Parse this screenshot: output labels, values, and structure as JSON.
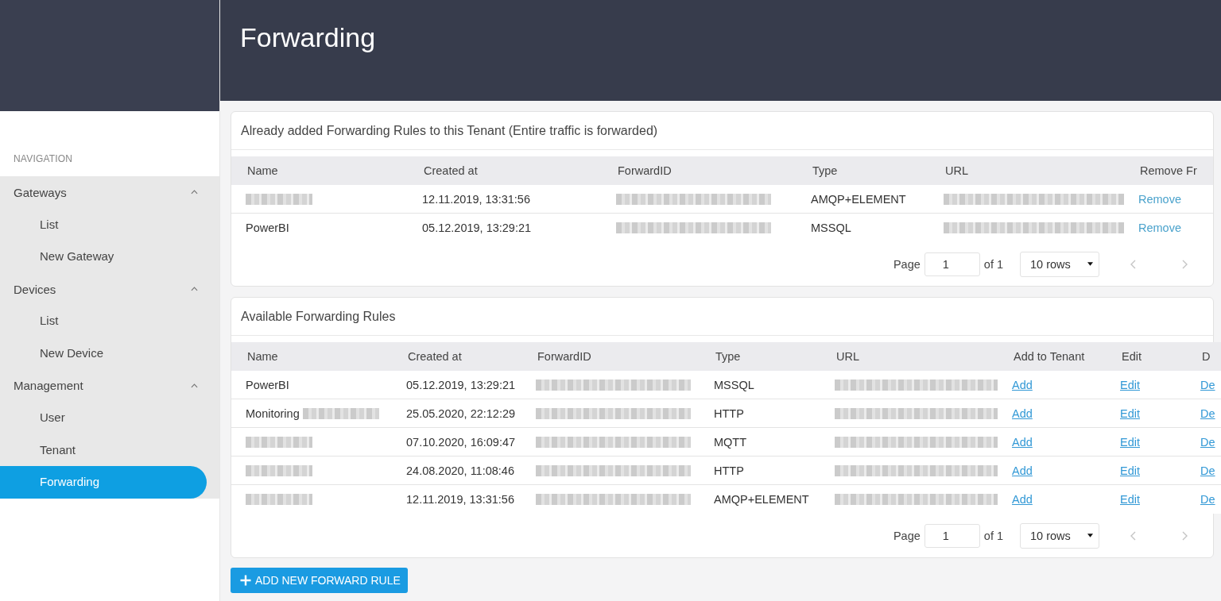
{
  "sidebar": {
    "heading": "NAVIGATION",
    "groups": [
      {
        "label": "Gateways",
        "expanded": true,
        "children": [
          {
            "label": "List",
            "selected": false
          },
          {
            "label": "New Gateway",
            "selected": false
          }
        ]
      },
      {
        "label": "Devices",
        "expanded": true,
        "children": [
          {
            "label": "List",
            "selected": false
          },
          {
            "label": "New Device",
            "selected": false
          }
        ]
      },
      {
        "label": "Management",
        "expanded": true,
        "children": [
          {
            "label": "User",
            "selected": false
          },
          {
            "label": "Tenant",
            "selected": false
          },
          {
            "label": "Forwarding",
            "selected": true
          }
        ]
      }
    ]
  },
  "header": {
    "title": "Forwarding"
  },
  "assigned_rules": {
    "title": "Already added Forwarding Rules to this Tenant (Entire traffic is forwarded)",
    "columns": [
      "Name",
      "Created at",
      "ForwardID",
      "Type",
      "URL",
      "Remove Fr"
    ],
    "rows": [
      {
        "name_redacted": true,
        "created_at": "12.11.2019, 13:31:56",
        "forward_id_redacted": true,
        "type": "AMQP+ELEMENT",
        "url_redacted": true,
        "remove": "Remove"
      },
      {
        "name": "PowerBI",
        "name_redacted": false,
        "created_at": "05.12.2019, 13:29:21",
        "forward_id_redacted": true,
        "type": "MSSQL",
        "url_redacted": true,
        "remove": "Remove"
      }
    ],
    "pagination": {
      "label": "Page",
      "page": "1",
      "total": "of 1",
      "page_size": "10 rows",
      "prev_disabled": true,
      "next_disabled": true
    }
  },
  "available_rules": {
    "title": "Available Forwarding Rules",
    "columns": [
      "Name",
      "Created at",
      "ForwardID",
      "Type",
      "URL",
      "Add to Tenant",
      "Edit",
      "D"
    ],
    "rows": [
      {
        "name": "PowerBI",
        "name_redacted": false,
        "created_at": "05.12.2019, 13:29:21",
        "forward_id_redacted": true,
        "type": "MSSQL",
        "url_redacted": true,
        "add": "Add",
        "edit": "Edit",
        "delete": "De"
      },
      {
        "name": "Monitoring",
        "name_redacted": true,
        "created_at": "25.05.2020, 22:12:29",
        "forward_id_redacted": true,
        "type": "HTTP",
        "url_redacted": true,
        "add": "Add",
        "edit": "Edit",
        "delete": "De"
      },
      {
        "name_redacted": true,
        "created_at": "07.10.2020, 16:09:47",
        "forward_id_redacted": true,
        "type": "MQTT",
        "url_redacted": true,
        "add": "Add",
        "edit": "Edit",
        "delete": "De"
      },
      {
        "name_redacted": true,
        "created_at": "24.08.2020, 11:08:46",
        "forward_id_redacted": true,
        "type": "HTTP",
        "url_redacted": true,
        "add": "Add",
        "edit": "Edit",
        "delete": "De"
      },
      {
        "name_redacted": true,
        "created_at": "12.11.2019, 13:31:56",
        "forward_id_redacted": true,
        "type": "AMQP+ELEMENT",
        "url_redacted": true,
        "add": "Add",
        "edit": "Edit",
        "delete": "De"
      }
    ],
    "pagination": {
      "label": "Page",
      "page": "1",
      "total": "of 1",
      "page_size": "10 rows",
      "prev_disabled": true,
      "next_disabled": true
    }
  },
  "add_button": {
    "label": "ADD NEW FORWARD RULE"
  }
}
